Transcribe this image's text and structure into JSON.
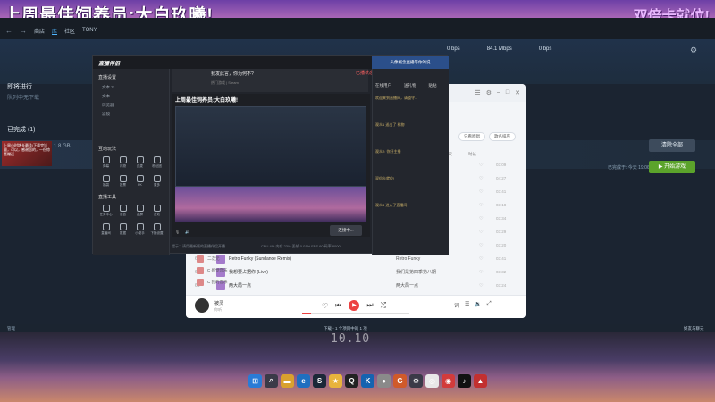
{
  "banner": {
    "left": "上周最佳饲养员:大白玖曦!",
    "right": "双倍卡就位!"
  },
  "steam": {
    "nav": [
      "商店",
      "库",
      "社区",
      "TONY"
    ],
    "net": [
      {
        "value": "0 bps",
        "label": ""
      },
      {
        "value": "84.1 Mbps",
        "label": ""
      },
      {
        "value": "0 bps",
        "label": ""
      }
    ],
    "sections": {
      "in_progress": "即将进行",
      "queue_hint": "队列中无下载",
      "done": "已完成 (1)"
    },
    "game_thumb_text": "上周小时增长最佳/下载完毕量，可以，感谢您的，一份惊喜赠送",
    "game_meta": "1.8 GB",
    "clear_label": "清除全部",
    "start_label": "▶ 开始游戏",
    "started_text": "已完成于: 今天 19:06",
    "bottom_manage": "管理",
    "bottom_download": "下载 - 1 个项目中的 1 项",
    "bottom_friends": "好友与聊天"
  },
  "music": {
    "tabs": [
      "只看原唱",
      "歌名排序"
    ],
    "cols": [
      "歌曲",
      "专辑",
      "喜欢",
      "时长"
    ],
    "songs": [
      {
        "num": "",
        "title": "",
        "artist": "",
        "album": "",
        "dur": "03:09"
      },
      {
        "num": "",
        "title": "",
        "artist": "",
        "album": "",
        "dur": "04:27"
      },
      {
        "num": "",
        "title": "",
        "artist": "",
        "album": "",
        "dur": "03:41"
      },
      {
        "num": "",
        "title": "",
        "artist": "",
        "album": "",
        "dur": "03:18"
      },
      {
        "num": "",
        "title": "",
        "artist": "",
        "album": "",
        "dur": "03:34"
      },
      {
        "num": "",
        "title": "",
        "artist": "",
        "album": "",
        "dur": "03:29"
      },
      {
        "num": "",
        "title": "",
        "artist": "",
        "album": "",
        "dur": "03:20"
      },
      {
        "num": "61",
        "title": "Retro Funky (Sundance Remix)",
        "artist": "Pandaphone",
        "album": "Retro Funky",
        "dur": "03:41"
      },
      {
        "num": "62",
        "title": "我想要占据你 (Live)",
        "artist": "",
        "album": "我们是第四季第八期",
        "dur": "03:32"
      },
      {
        "num": "63",
        "title": "两大局一点",
        "artist": "",
        "album": "两大局一点",
        "dur": "03:24"
      }
    ],
    "left_items": [
      "二次元",
      "C 感觉音乐",
      "C 我的音乐"
    ],
    "player_name": "被灵",
    "player_sub": "",
    "lyrics": "你听"
  },
  "stream": {
    "logo": "直播伴侣",
    "title": "我发此言，你为何不?",
    "sub": "热门游戏  |  Steam",
    "live_status": "已播状态",
    "banner_in_preview": "上周最佳饲养员:大白玖曦!",
    "live_btn": "连接中...",
    "chat_banner": "头像概念直播等你的说",
    "chat_tabs": [
      "在线用户",
      "送礼物",
      "贴贴"
    ],
    "chat_msgs": [
      "欢迎来到直播间，请遵守...",
      "观众1 送出了 礼物",
      "观众2: 你好主播",
      "双倍卡就位!",
      "观众3 进入了直播间"
    ],
    "left_head_1": "直播设置",
    "left_rows": [
      "文本 2",
      "文本",
      "浏览器",
      "滤镜"
    ],
    "left_head_2": "互动玩法",
    "left_head_3": "直播工具",
    "tools_1": [
      "弹幕",
      "礼物",
      "连麦",
      "粉丝团",
      "福袋",
      "投票",
      "PK",
      "更多"
    ],
    "tools_2": [
      "任务中心",
      "语音",
      "截屏",
      "音效",
      "直播间",
      "数据",
      "小助手",
      "下播设置"
    ],
    "status": "提示：请用最新版的直播伴侣开播",
    "stats": "CPU 4%  内存 23%  丢帧 0.01%  FPS 60  码率 8000"
  },
  "desktop": {
    "clock": "10.10",
    "taskbar_icons": [
      {
        "icon": "windows-icon",
        "color": "#2a7bd6",
        "glyph": "⊞"
      },
      {
        "icon": "search-icon",
        "color": "#3a3a48",
        "glyph": "⌕"
      },
      {
        "icon": "folder-icon",
        "color": "#d9a12e",
        "glyph": "▬"
      },
      {
        "icon": "browser-icon",
        "color": "#1f6fc0",
        "glyph": "e"
      },
      {
        "icon": "steam-icon",
        "color": "#1b2838",
        "glyph": "S"
      },
      {
        "icon": "app-icon",
        "color": "#e8b33c",
        "glyph": "★"
      },
      {
        "icon": "qq-icon",
        "color": "#222",
        "glyph": "Q"
      },
      {
        "icon": "kugou-icon",
        "color": "#1563b0",
        "glyph": "K"
      },
      {
        "icon": "app-icon-2",
        "color": "#8a8a8a",
        "glyph": "●"
      },
      {
        "icon": "game-icon",
        "color": "#d05a2a",
        "glyph": "G"
      },
      {
        "icon": "tool-icon",
        "color": "#3a3a48",
        "glyph": "⚙"
      },
      {
        "icon": "app-icon-3",
        "color": "#e8e8e8",
        "glyph": "◎"
      },
      {
        "icon": "netease-icon",
        "color": "#d23b3b",
        "glyph": "◉"
      },
      {
        "icon": "douyin-icon",
        "color": "#111",
        "glyph": "♪"
      },
      {
        "icon": "app-icon-4",
        "color": "#c23030",
        "glyph": "▲"
      }
    ]
  }
}
